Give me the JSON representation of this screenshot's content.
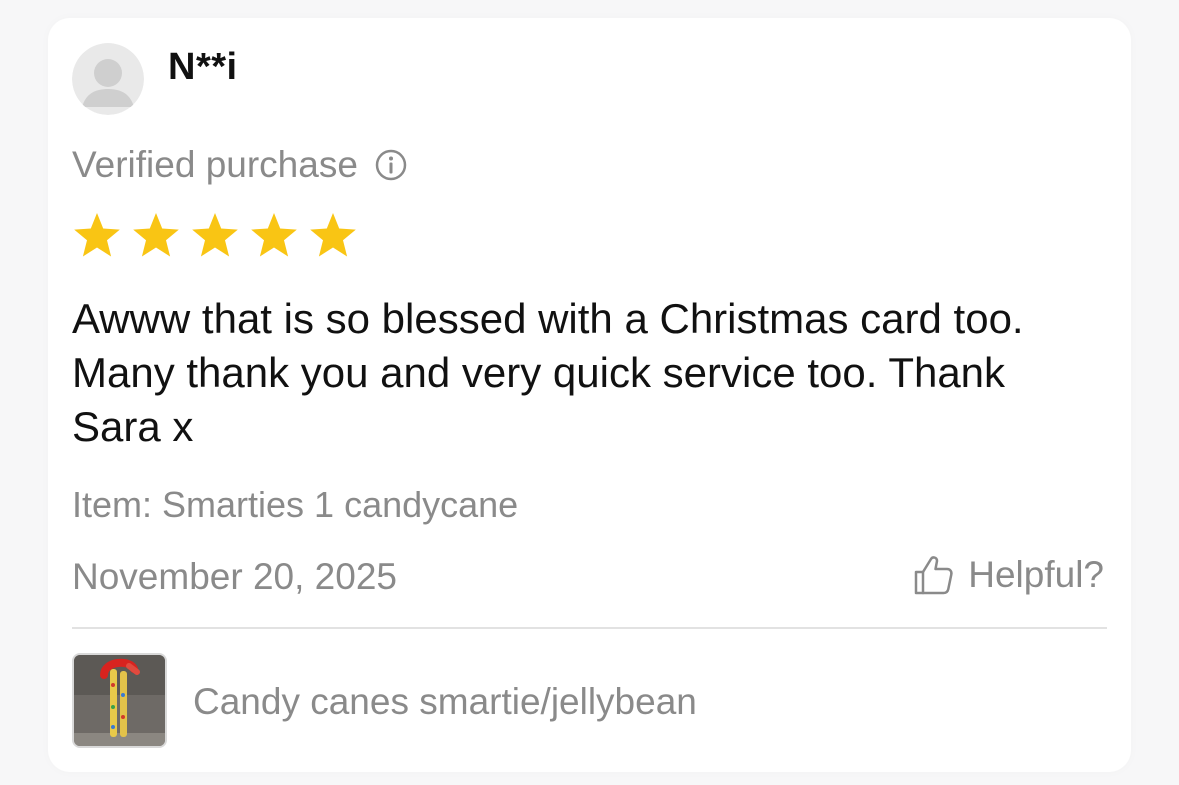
{
  "review": {
    "reviewer_name": "N**i",
    "verified_label": "Verified purchase",
    "rating": 5,
    "rating_max": 5,
    "text": "Awww that is so blessed with a Christmas card too. Many thank you and very quick service too. Thank Sara x",
    "item_label": "Item: Smarties 1 candycane",
    "date": "November 20, 2025",
    "helpful_label": "Helpful?"
  },
  "product": {
    "name": "Candy canes smartie/jellybean"
  },
  "icons": {
    "avatar": "default-user-avatar",
    "info": "info-circle-icon",
    "star": "star-icon",
    "helpful": "thumbs-up-icon"
  },
  "colors": {
    "star": "#F9C514",
    "muted_text": "#8A8A8A",
    "primary_text": "#111111"
  }
}
